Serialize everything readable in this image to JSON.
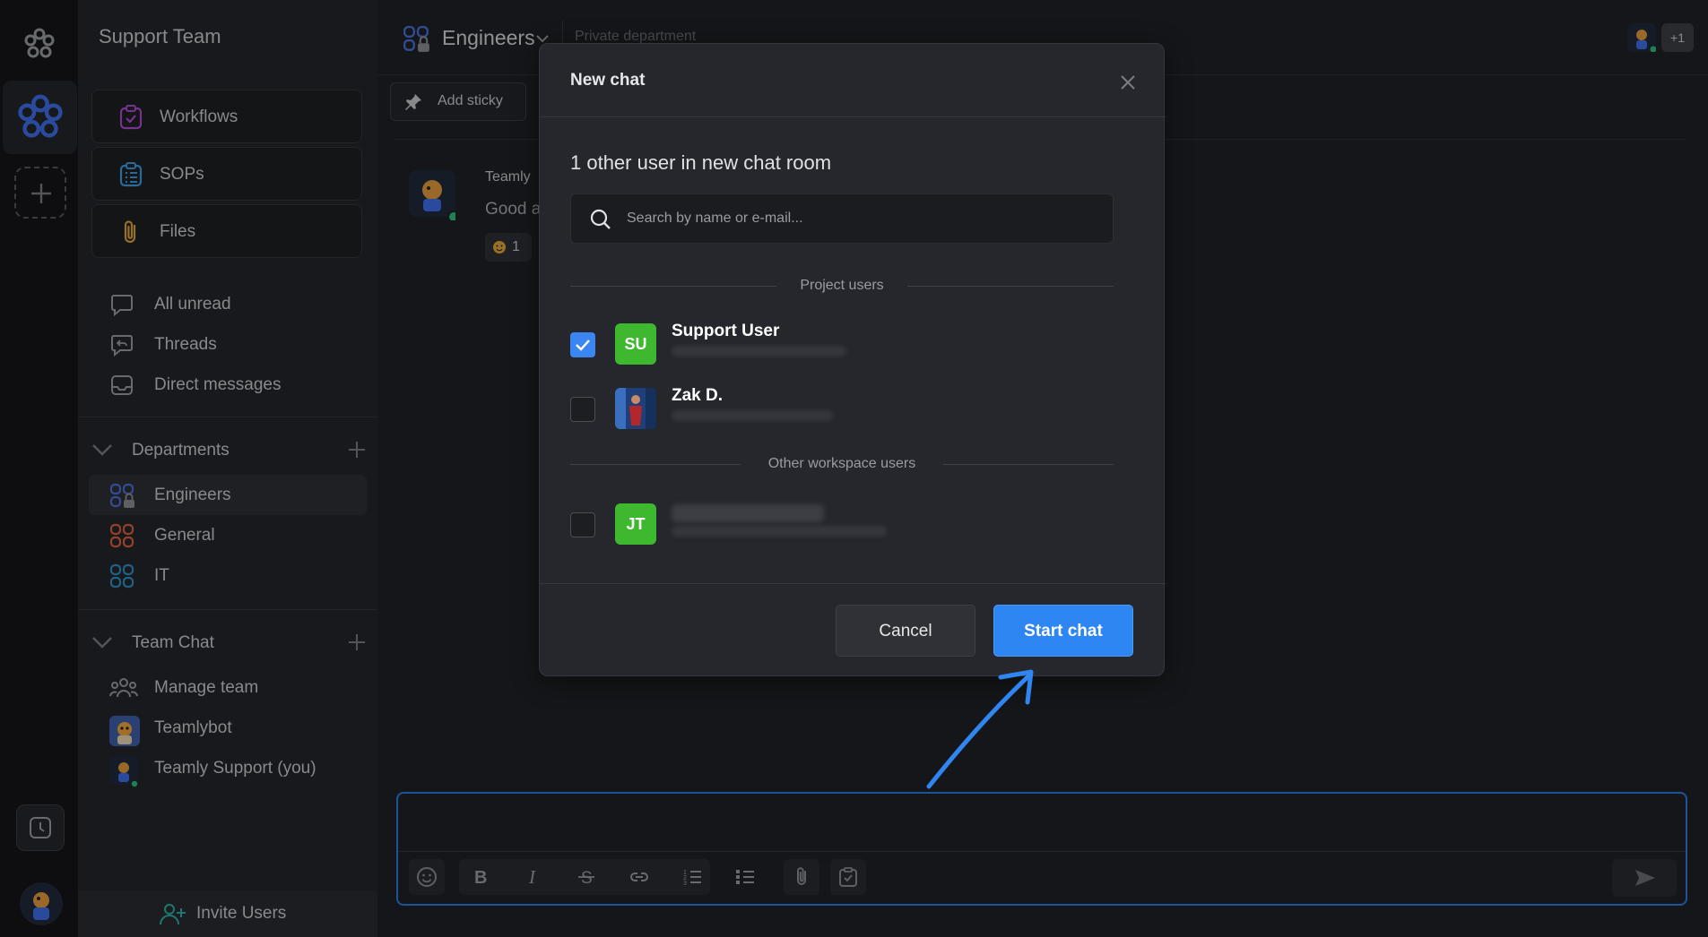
{
  "workspace": {
    "name": "Support Team"
  },
  "sidebar": {
    "cards": [
      {
        "label": "Workflows",
        "icon": "workflows-icon"
      },
      {
        "label": "SOPs",
        "icon": "sops-icon"
      },
      {
        "label": "Files",
        "icon": "paperclip-icon"
      }
    ],
    "nav": [
      {
        "label": "All unread"
      },
      {
        "label": "Threads"
      },
      {
        "label": "Direct messages"
      }
    ],
    "departments": {
      "title": "Departments",
      "items": [
        {
          "label": "Engineers",
          "color": "#4b6fd6"
        },
        {
          "label": "General",
          "color": "#d9623a"
        },
        {
          "label": "IT",
          "color": "#2e8fc4"
        }
      ]
    },
    "team_chat": {
      "title": "Team Chat",
      "items": [
        {
          "label": "Manage team"
        },
        {
          "label": "Teamlybot"
        },
        {
          "label": "Teamly Support (you)"
        }
      ]
    },
    "invite_label": "Invite Users"
  },
  "channel": {
    "title": "Engineers",
    "subtitle": "Private department",
    "add_sticky": "Add sticky",
    "members_extra": "+1"
  },
  "message": {
    "author": "Teamly",
    "text": "Good a",
    "reaction_count": "1"
  },
  "modal": {
    "title": "New chat",
    "count_text": "1 other user in new chat room",
    "search_placeholder": "Search by name or e-mail...",
    "project_users_label": "Project users",
    "other_users_label": "Other workspace users",
    "users": [
      {
        "initials": "SU",
        "name": "Support User",
        "checked": true,
        "color": "#3db82f"
      },
      {
        "initials": "",
        "name": "Zak D.",
        "checked": false,
        "color": "#2a4c8a"
      },
      {
        "initials": "JT",
        "name": "",
        "checked": false,
        "color": "#3db82f"
      }
    ],
    "cancel_label": "Cancel",
    "start_label": "Start chat"
  },
  "colors": {
    "accent": "#2e86f2",
    "checkbox_on": "#3b86f0"
  }
}
